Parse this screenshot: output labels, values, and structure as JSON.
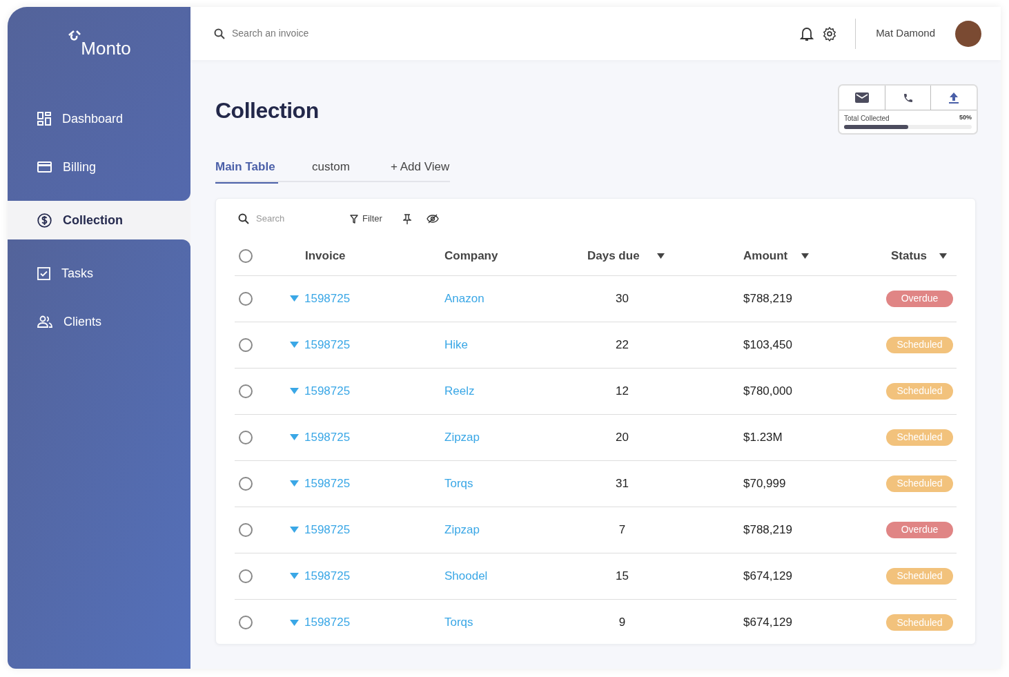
{
  "sidebar": {
    "logo": "Monto",
    "items": [
      {
        "label": "Dashboard",
        "selected": false
      },
      {
        "label": "Billing",
        "selected": false
      },
      {
        "label": "Collection",
        "selected": true
      },
      {
        "label": "Tasks",
        "selected": false
      },
      {
        "label": "Clients",
        "selected": false
      }
    ]
  },
  "header": {
    "search": {
      "placeholder": "Search an invoice"
    },
    "user": "Mat Damond"
  },
  "page_title": "Collection",
  "collected_widget": {
    "label": "Total Collected",
    "reading": "50%",
    "level": 0.5
  },
  "tabs": [
    {
      "label": "Main Table",
      "selected": true
    },
    {
      "label": "custom",
      "selected": false
    },
    {
      "label": "+ Add View",
      "selected": false
    }
  ],
  "toolbar": {
    "search": {
      "placeholder": "Search"
    },
    "filter": "Filter"
  },
  "table": {
    "select_all_checked": false,
    "columns": [
      {
        "label": "Invoice",
        "sortable": false
      },
      {
        "label": "Company",
        "sortable": false
      },
      {
        "label": "Days due",
        "sortable": true
      },
      {
        "label": "Amount",
        "sortable": true
      },
      {
        "label": "Status",
        "sortable": true
      }
    ],
    "rows": [
      {
        "checked": false,
        "invoice": "1598725",
        "company": "Anazon",
        "days_due": "30",
        "amount": "$788,219",
        "status": {
          "text": "Overdue",
          "kind": "overdue"
        }
      },
      {
        "checked": false,
        "invoice": "1598725",
        "company": "Hike",
        "days_due": "22",
        "amount": "$103,450",
        "status": {
          "text": "Scheduled",
          "kind": "scheduled"
        }
      },
      {
        "checked": false,
        "invoice": "1598725",
        "company": "Reelz",
        "days_due": "12",
        "amount": "$780,000",
        "status": {
          "text": "Scheduled",
          "kind": "scheduled"
        }
      },
      {
        "checked": false,
        "invoice": "1598725",
        "company": "Zipzap",
        "days_due": "20",
        "amount": "$1.23M",
        "status": {
          "text": "Scheduled",
          "kind": "scheduled"
        }
      },
      {
        "checked": false,
        "invoice": "1598725",
        "company": "Torqs",
        "days_due": "31",
        "amount": "$70,999",
        "status": {
          "text": "Scheduled",
          "kind": "scheduled"
        }
      },
      {
        "checked": false,
        "invoice": "1598725",
        "company": "Zipzap",
        "days_due": "7",
        "amount": "$788,219",
        "status": {
          "text": "Overdue",
          "kind": "overdue"
        }
      },
      {
        "checked": false,
        "invoice": "1598725",
        "company": "Shoodel",
        "days_due": "15",
        "amount": "$674,129",
        "status": {
          "text": "Scheduled",
          "kind": "scheduled"
        }
      },
      {
        "checked": false,
        "invoice": "1598725",
        "company": "Torqs",
        "days_due": "9",
        "amount": "$674,129",
        "status": {
          "text": "Scheduled",
          "kind": "scheduled"
        }
      }
    ]
  }
}
